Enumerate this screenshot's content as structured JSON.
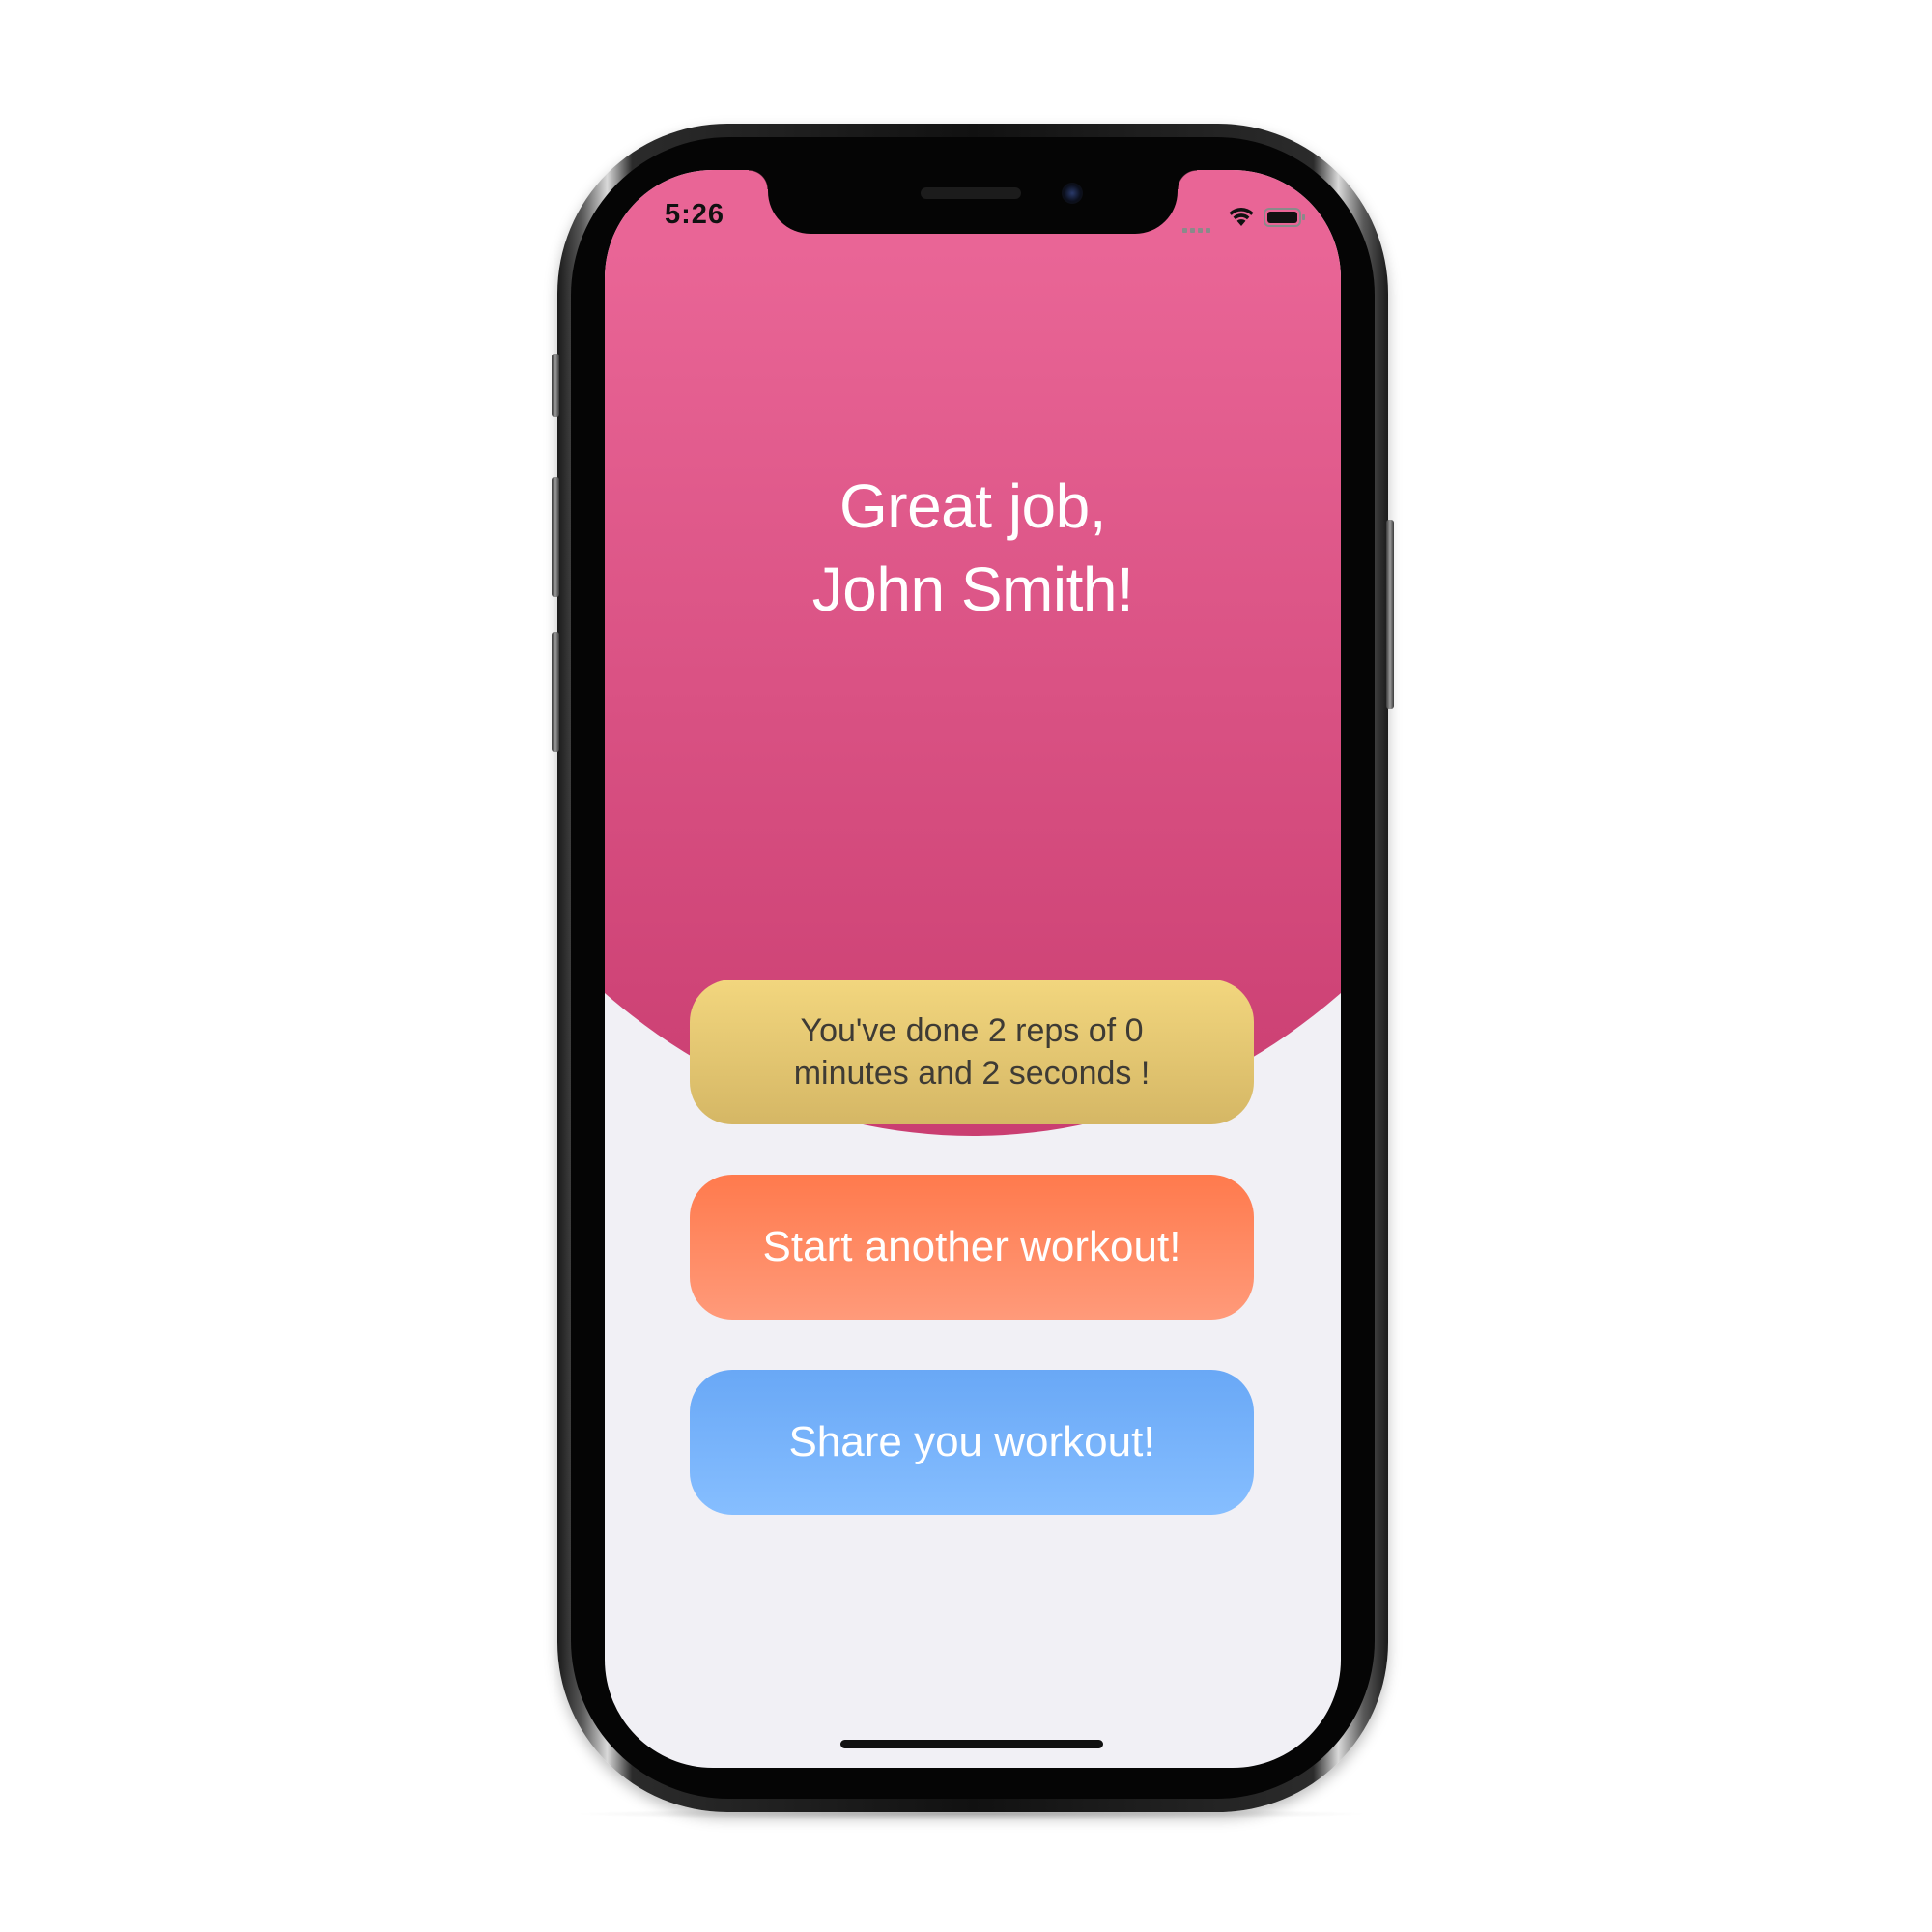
{
  "status_bar": {
    "time": "5:26"
  },
  "hero": {
    "title_line1": "Great job,",
    "title_line2": "John Smith!"
  },
  "summary": {
    "line1": "You've done 2 reps of 0",
    "line2": "minutes and 2 seconds !"
  },
  "actions": {
    "start_label": "Start another workout!",
    "share_label": "Share you workout!"
  },
  "colors": {
    "hero_top": "#e96596",
    "hero_bottom": "#ca3e71",
    "summary_top": "#f2d67e",
    "summary_bottom": "#d5b765",
    "start_top": "#ff7a4d",
    "start_bottom": "#ff9a7a",
    "share_top": "#69a8f6",
    "share_bottom": "#86beff",
    "screen_background": "#f1f0f5"
  },
  "icons": [
    "wifi-icon",
    "battery-icon",
    "signal-icon"
  ]
}
